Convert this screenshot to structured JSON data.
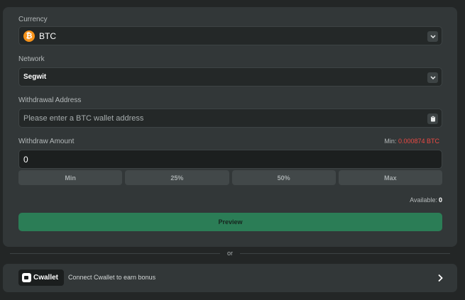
{
  "currency": {
    "label": "Currency",
    "value": "BTC",
    "coin_symbol": "₿",
    "coin_color": "#f7931a",
    "icon": "bitcoin-icon"
  },
  "network": {
    "label": "Network",
    "value": "Segwit"
  },
  "address": {
    "label": "Withdrawal Address",
    "placeholder": "Please enter a BTC wallet address",
    "paste_icon": "clipboard-icon"
  },
  "amount": {
    "label": "Withdraw Amount",
    "min_label": "Min:",
    "min_value": "0.000874 BTC",
    "value": "0"
  },
  "percent_buttons": [
    "Min",
    "25%",
    "50%",
    "Max"
  ],
  "available": {
    "label": "Available:",
    "value": "0"
  },
  "preview_label": "Preview",
  "divider_text": "or",
  "cwallet": {
    "logo_text": "Cwallet",
    "text": "Connect Cwallet to earn bonus",
    "arrow_icon": "chevron-right-icon"
  },
  "colors": {
    "accent_green": "#2b7d56",
    "min_red": "#ed4a44",
    "panel": "#323738",
    "background": "#232626"
  }
}
